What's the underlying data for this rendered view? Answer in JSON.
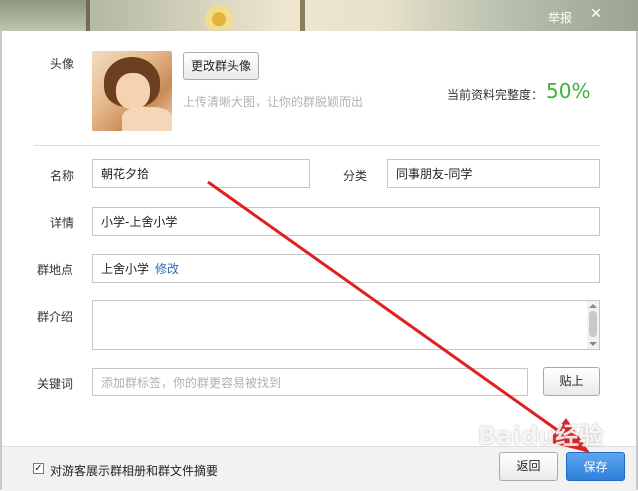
{
  "titlebar": {
    "report_label": "举报",
    "close_glyph": "✕"
  },
  "avatar": {
    "label": "头像",
    "change_button": "更改群头像",
    "hint": "上传清晰大图，让你的群脱颖而出"
  },
  "completeness": {
    "label": "当前资料完整度：",
    "value": "50%",
    "color": "#3cb43c"
  },
  "form": {
    "name_label": "名称",
    "name_value": "朝花夕拾",
    "category_label": "分类",
    "category_value": "同事朋友-同学",
    "details_label": "详情",
    "details_value": "小学-上舍小学",
    "location_label": "群地点",
    "location_value": "上舍小学",
    "location_edit": "修改",
    "intro_label": "群介绍",
    "intro_value": "",
    "keywords_label": "关键词",
    "keywords_placeholder": "添加群标签，你的群更容易被找到",
    "paste_button": "贴上"
  },
  "footer": {
    "checkbox_checked": true,
    "checkbox_mark": "✓",
    "checkbox_label": "对游客展示群相册和群文件摘要",
    "back_button": "返回",
    "save_button": "保存"
  },
  "watermark": "Baidu经验",
  "annotation": {
    "arrow_color": "#e02020"
  }
}
